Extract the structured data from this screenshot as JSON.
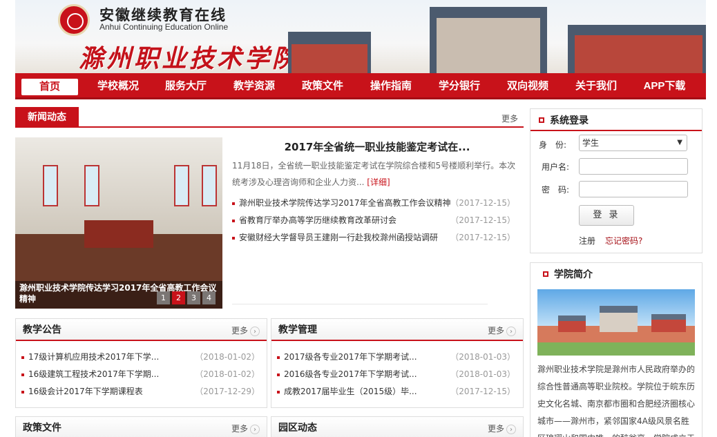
{
  "header": {
    "site_name_cn": "安徽继续教育在线",
    "site_name_en": "Anhui Continuing Education Online",
    "college_name": "滁州职业技术学院"
  },
  "nav": {
    "items": [
      {
        "label": "首页",
        "active": true
      },
      {
        "label": "学校概况"
      },
      {
        "label": "服务大厅"
      },
      {
        "label": "教学资源"
      },
      {
        "label": "政策文件"
      },
      {
        "label": "操作指南"
      },
      {
        "label": "学分银行"
      },
      {
        "label": "双向视频"
      },
      {
        "label": "关于我们"
      },
      {
        "label": "APP下载"
      }
    ]
  },
  "news": {
    "tab_label": "新闻动态",
    "more": "更多",
    "photo_caption": "滁州职业技术学院传达学习2017年全省高教工作会议精神",
    "carousel": [
      "1",
      "2",
      "3",
      "4"
    ],
    "active_slide": 2,
    "headline": "2017年全省统一职业技能鉴定考试在...",
    "summary": "11月18日，全省统一职业技能鉴定考试在学院综合楼和5号楼顺利举行。本次统考涉及心理咨询师和企业人力资...",
    "detail_link": "[详细]",
    "items": [
      {
        "title": "滁州职业技术学院传达学习2017年全省高教工作会议精神",
        "date": "（2017-12-15）"
      },
      {
        "title": "省教育厅举办高等学历继续教育改革研讨会",
        "date": "（2017-12-15）"
      },
      {
        "title": "安徽财经大学督导员王建刚一行赴我校滁州函授站调研",
        "date": "（2017-12-15）"
      }
    ]
  },
  "announcements": {
    "title": "教学公告",
    "more": "更多",
    "arrow": "›",
    "items": [
      {
        "title": "17级计算机应用技术2017年下学...",
        "date": "（2018-01-02）"
      },
      {
        "title": "16级建筑工程技术2017年下学期...",
        "date": "（2018-01-02）"
      },
      {
        "title": "16级会计2017年下学期课程表",
        "date": "（2017-12-29）"
      }
    ]
  },
  "teaching": {
    "title": "教学管理",
    "more": "更多",
    "arrow": "›",
    "items": [
      {
        "title": "2017级各专业2017年下学期考试...",
        "date": "（2018-01-03）"
      },
      {
        "title": "2016级各专业2017年下学期考试...",
        "date": "（2018-01-03）"
      },
      {
        "title": "成教2017届毕业生（2015级）毕...",
        "date": "（2017-12-15）"
      }
    ]
  },
  "policy": {
    "title": "政策文件",
    "more": "更多",
    "arrow": "›"
  },
  "campus_news": {
    "title": "园区动态",
    "more": "更多",
    "arrow": "›"
  },
  "login": {
    "title": "系统登录",
    "identity_label": "身　份:",
    "identity_value": "学生",
    "caret": "▼",
    "username_label": "用户名:",
    "password_label": "密　码:",
    "button": "登 录",
    "register": "注册",
    "forgot": "忘记密码?"
  },
  "about": {
    "title": "学院简介",
    "text": "滁州职业技术学院是滁州市人民政府举办的综合性普通高等职业院校。学院位于皖东历史文化名城、南京都市圈和合肥经济圈核心城市——滁州市，紧邻国家4A级风景名胜区琅琊山和国内唯一的醉翁亭，学院成立于"
  },
  "colors": {
    "brand_red": "#c8121a"
  }
}
